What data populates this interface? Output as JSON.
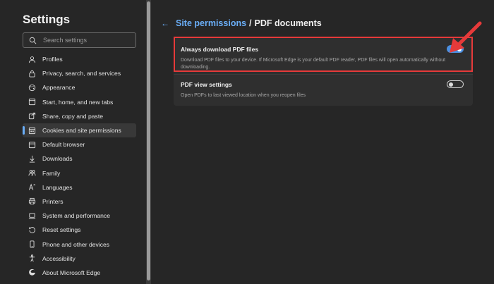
{
  "sidebar": {
    "title": "Settings",
    "search_placeholder": "Search settings",
    "items": [
      {
        "label": "Profiles",
        "icon": "profile-icon"
      },
      {
        "label": "Privacy, search, and services",
        "icon": "lock-icon"
      },
      {
        "label": "Appearance",
        "icon": "appearance-icon"
      },
      {
        "label": "Start, home, and new tabs",
        "icon": "home-icon"
      },
      {
        "label": "Share, copy and paste",
        "icon": "share-icon"
      },
      {
        "label": "Cookies and site permissions",
        "icon": "cookies-icon",
        "active": true
      },
      {
        "label": "Default browser",
        "icon": "browser-icon"
      },
      {
        "label": "Downloads",
        "icon": "download-icon"
      },
      {
        "label": "Family",
        "icon": "family-icon"
      },
      {
        "label": "Languages",
        "icon": "languages-icon"
      },
      {
        "label": "Printers",
        "icon": "printer-icon"
      },
      {
        "label": "System and performance",
        "icon": "system-icon"
      },
      {
        "label": "Reset settings",
        "icon": "reset-icon"
      },
      {
        "label": "Phone and other devices",
        "icon": "phone-icon"
      },
      {
        "label": "Accessibility",
        "icon": "accessibility-icon"
      },
      {
        "label": "About Microsoft Edge",
        "icon": "edge-icon"
      }
    ]
  },
  "header": {
    "breadcrumb_link": "Site permissions",
    "separator": "/",
    "current": "PDF documents"
  },
  "settings": [
    {
      "label": "Always download PDF files",
      "description": "Download PDF files to your device. If Microsoft Edge is your default PDF reader, PDF files will open automatically without downloading.",
      "enabled": true
    },
    {
      "label": "PDF view settings",
      "description": "Open PDFs to last viewed location when you reopen files",
      "enabled": false
    }
  ],
  "colors": {
    "accent": "#6aaef7",
    "toggle_on": "#4c8fe0",
    "highlight": "#e63a3a",
    "background": "#262626",
    "card": "#2f2f2f"
  }
}
